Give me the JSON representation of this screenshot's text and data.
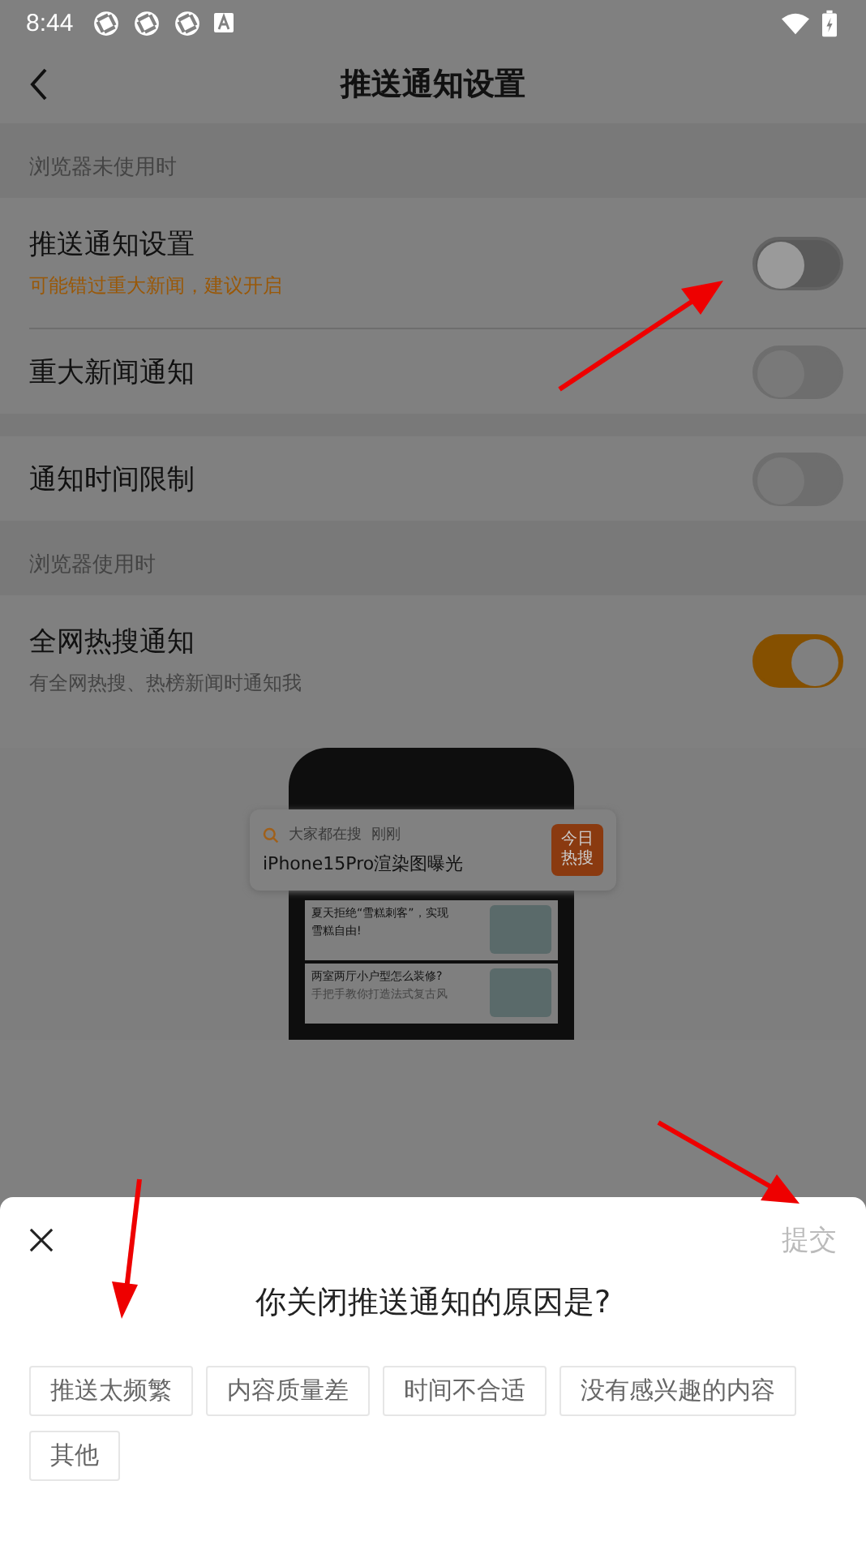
{
  "status_bar": {
    "time": "8:44"
  },
  "header": {
    "title": "推送通知设置"
  },
  "sections": [
    {
      "title": "浏览器未使用时",
      "items": [
        {
          "label": "推送通知设置",
          "hint": "可能错过重大新闻，建议开启",
          "warning": true,
          "on": false,
          "disabled": false
        },
        {
          "label": "重大新闻通知",
          "on": false,
          "disabled": true
        },
        {
          "label": "通知时间限制",
          "on": false,
          "disabled": true
        }
      ]
    },
    {
      "title": "浏览器使用时",
      "items": [
        {
          "label": "全网热搜通知",
          "hint": "有全网热搜、热榜新闻时通知我",
          "warning": false,
          "on": true,
          "disabled": false
        }
      ]
    }
  ],
  "promo": {
    "search_label": "大家都在搜",
    "time": "刚刚",
    "headline": "iPhone15Pro渲染图曝光",
    "badge": [
      "今日",
      "热搜"
    ],
    "articles": [
      {
        "lines": [
          "夏天拒绝“雪糕刺客”，实现",
          "雪糕自由!"
        ]
      },
      {
        "lines": [
          "两室两厅小户型怎么装修?",
          "手把手教你打造法式复古风"
        ]
      }
    ]
  },
  "sheet": {
    "title": "你关闭推送通知的原因是?",
    "submit": "提交",
    "submit_disabled": true,
    "options": [
      {
        "label": "推送太频繁",
        "selected": false
      },
      {
        "label": "内容质量差",
        "selected": false
      },
      {
        "label": "时间不合适",
        "selected": false
      },
      {
        "label": "没有感兴趣的内容",
        "selected": false
      },
      {
        "label": "其他",
        "selected": false
      }
    ]
  }
}
